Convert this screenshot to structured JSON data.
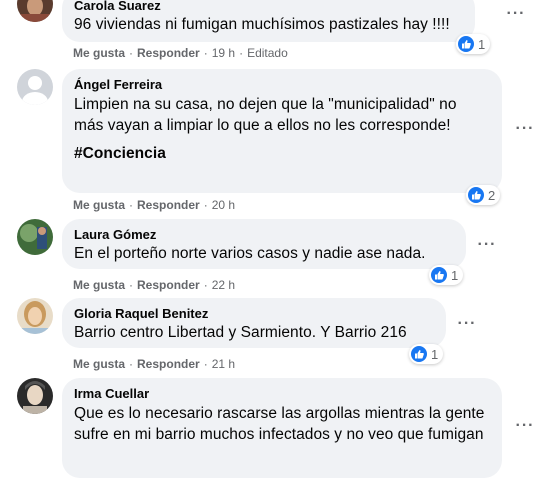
{
  "comments": [
    {
      "author": "Carola Suarez",
      "text": "96 viviendas ni fumigan muchísimos pastizales hay !!!!",
      "like_label": "Me gusta",
      "reply_label": "Responder",
      "time": "19 h",
      "edited": "Editado",
      "reactions": "1",
      "avatar_colors": [
        "#5a3b2e",
        "#c99a7a"
      ]
    },
    {
      "author": "Ángel Ferreira",
      "text": "Limpien na su casa, no dejen que la \"municipalidad\" no más vayan a limpiar lo que a ellos no les corresponde!",
      "hashtag": "#Conciencia",
      "like_label": "Me gusta",
      "reply_label": "Responder",
      "time": "20 h",
      "reactions": "2",
      "avatar_colors": [
        "#d0d4da",
        "#ffffff"
      ]
    },
    {
      "author": "Laura Gómez",
      "text": "En el porteño norte varios casos y nadie ase nada.",
      "like_label": "Me gusta",
      "reply_label": "Responder",
      "time": "22 h",
      "reactions": "1",
      "avatar_colors": [
        "#3f6b3a",
        "#7aa36a"
      ]
    },
    {
      "author": "Gloria Raquel Benitez",
      "text": "Barrio centro Libertad y Sarmiento. Y Barrio 216",
      "like_label": "Me gusta",
      "reply_label": "Responder",
      "time": "21 h",
      "reactions": "1",
      "avatar_colors": [
        "#c99a5e",
        "#f1d2b0"
      ]
    },
    {
      "author": "Irma Cuellar",
      "text": "Que es lo necesario rascarse las argollas mientras la gente sufre en mi barrio muchos infectados y no veo que fumigan",
      "avatar_colors": [
        "#2a2a2a",
        "#e8d7c4"
      ]
    }
  ],
  "icons": {
    "like": "like-thumb-icon",
    "more": "more-options-icon"
  },
  "colors": {
    "bubble": "#f0f2f5",
    "secondary_text": "#65676b",
    "like_blue": "#1877f2"
  }
}
